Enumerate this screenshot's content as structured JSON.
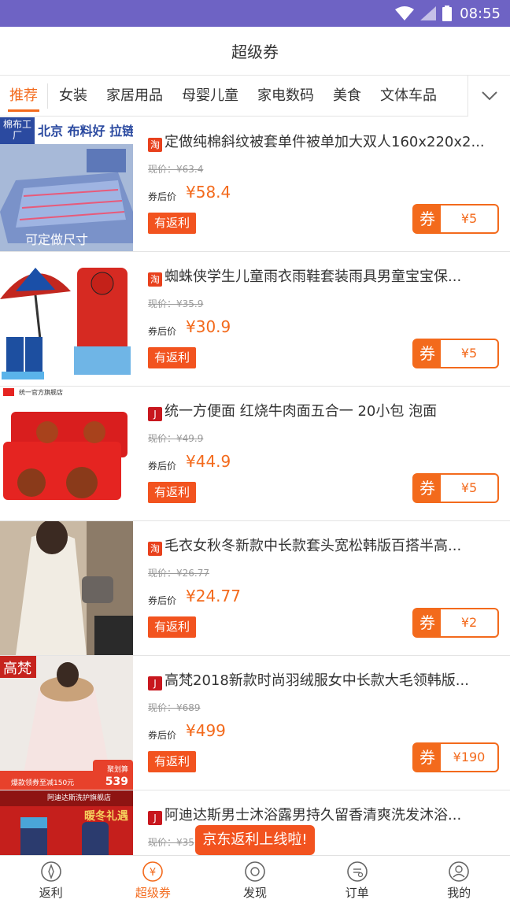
{
  "status_bar": {
    "time": "08:55"
  },
  "header": {
    "title": "超级券"
  },
  "tabs": [
    {
      "label": "推荐",
      "active": true
    },
    {
      "label": "女装"
    },
    {
      "label": "家居用品"
    },
    {
      "label": "母婴儿童"
    },
    {
      "label": "家电数码"
    },
    {
      "label": "美食"
    },
    {
      "label": "文体车品"
    }
  ],
  "products": [
    {
      "platform": "taobao",
      "badge": "淘",
      "title": "定做纯棉斜纹被套单件被单加大双人160x220x2...",
      "orig_price": "现价：¥63.4",
      "after_label": "券后价",
      "after_price": "¥58.4",
      "fanli": "有返利",
      "coupon_label": "券",
      "coupon_value": "¥5",
      "thumb_text": "北京 布料好 拉链好",
      "thumb_sub": "棉布工厂",
      "thumb_bottom": "可定做尺寸"
    },
    {
      "platform": "taobao",
      "badge": "淘",
      "title": "蜘蛛侠学生儿童雨衣雨鞋套装雨具男童宝宝保...",
      "orig_price": "现价：¥35.9",
      "after_label": "券后价",
      "after_price": "¥30.9",
      "fanli": "有返利",
      "coupon_label": "券",
      "coupon_value": "¥5"
    },
    {
      "platform": "jd",
      "badge": "J",
      "title": "统一方便面 红烧牛肉面五合一 20小包 泡面",
      "orig_price": "现价：¥49.9",
      "after_label": "券后价",
      "after_price": "¥44.9",
      "fanli": "有返利",
      "coupon_label": "券",
      "coupon_value": "¥5",
      "thumb_text": "统一官方旗舰店"
    },
    {
      "platform": "taobao",
      "badge": "淘",
      "title": "毛衣女秋冬新款中长款套头宽松韩版百搭半高...",
      "orig_price": "现价：¥26.77",
      "after_label": "券后价",
      "after_price": "¥24.77",
      "fanli": "有返利",
      "coupon_label": "券",
      "coupon_value": "¥2"
    },
    {
      "platform": "jd",
      "badge": "J",
      "title": "高梵2018新款时尚羽绒服女中长款大毛领韩版...",
      "orig_price": "现价：¥689",
      "after_label": "券后价",
      "after_price": "¥499",
      "fanli": "有返利",
      "coupon_label": "券",
      "coupon_value": "¥190",
      "thumb_text": "高梵",
      "thumb_banner": "爆款领券至减150元",
      "thumb_price": "539",
      "thumb_tag": "聚划算"
    },
    {
      "platform": "jd",
      "badge": "J",
      "title": "阿迪达斯男士沐浴露男持久留香清爽洗发沐浴...",
      "orig_price": "现价：¥35",
      "thumb_text": "阿迪达斯洗护旗舰店",
      "thumb_tag": "暖冬礼遇"
    }
  ],
  "tooltip": "京东返利上线啦!",
  "bottom_nav": [
    {
      "label": "返利",
      "icon": "compass-icon"
    },
    {
      "label": "超级券",
      "icon": "coupon-yen-icon",
      "active": true
    },
    {
      "label": "发现",
      "icon": "discover-icon"
    },
    {
      "label": "订单",
      "icon": "order-icon"
    },
    {
      "label": "我的",
      "icon": "profile-icon"
    }
  ],
  "colors": {
    "status_bar": "#6e63c4",
    "accent": "#f36a1c",
    "fanli_red": "#f2531f"
  }
}
